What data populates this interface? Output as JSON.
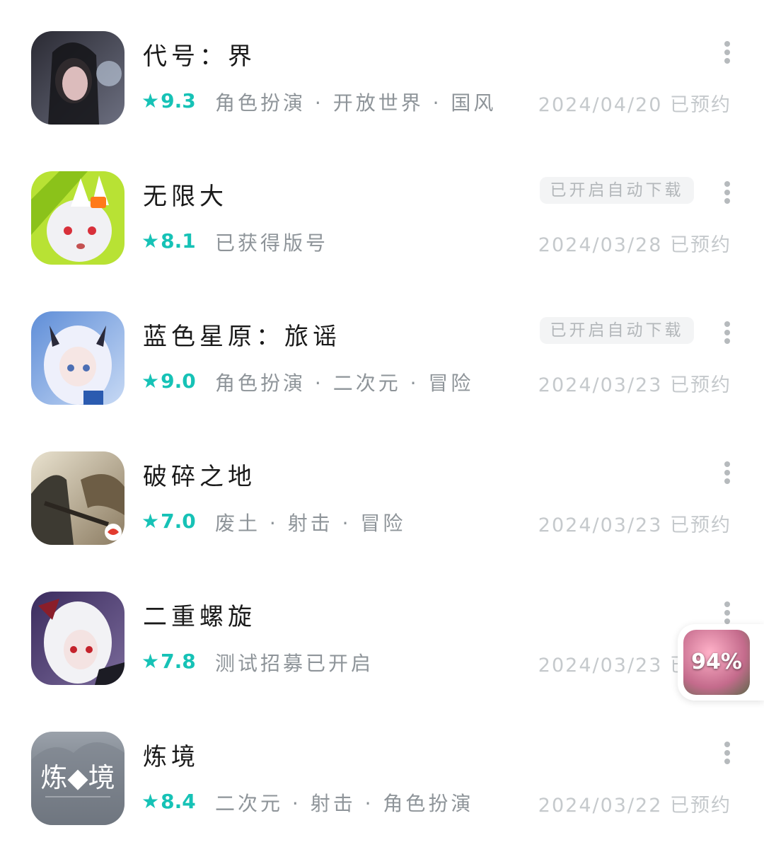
{
  "games": [
    {
      "name": "代号：界",
      "rating": "9.3",
      "tags": "角色扮演 · 开放世界 · 国风",
      "date": "2024/04/20 已预约",
      "badge": ""
    },
    {
      "name": "无限大",
      "rating": "8.1",
      "tags": "已获得版号",
      "date": "2024/03/28 已预约",
      "badge": "已开启自动下载"
    },
    {
      "name": "蓝色星原：旅谣",
      "rating": "9.0",
      "tags": "角色扮演 · 二次元 · 冒险",
      "date": "2024/03/23 已预约",
      "badge": "已开启自动下载"
    },
    {
      "name": "破碎之地",
      "rating": "7.0",
      "tags": "废土 · 射击 · 冒险",
      "date": "2024/03/23 已预约",
      "badge": ""
    },
    {
      "name": "二重螺旋",
      "rating": "7.8",
      "tags": "测试招募已开启",
      "date": "2024/03/23 已预约",
      "badge": ""
    },
    {
      "name": "炼境",
      "rating": "8.4",
      "tags": "二次元 · 射击 · 角色扮演",
      "date": "2024/03/22 已预约",
      "badge": "",
      "icon_text": "炼◆境"
    }
  ],
  "star_glyph": "★",
  "accent_color": "#16c2b6",
  "float_widget": {
    "progress_label": "94%"
  }
}
